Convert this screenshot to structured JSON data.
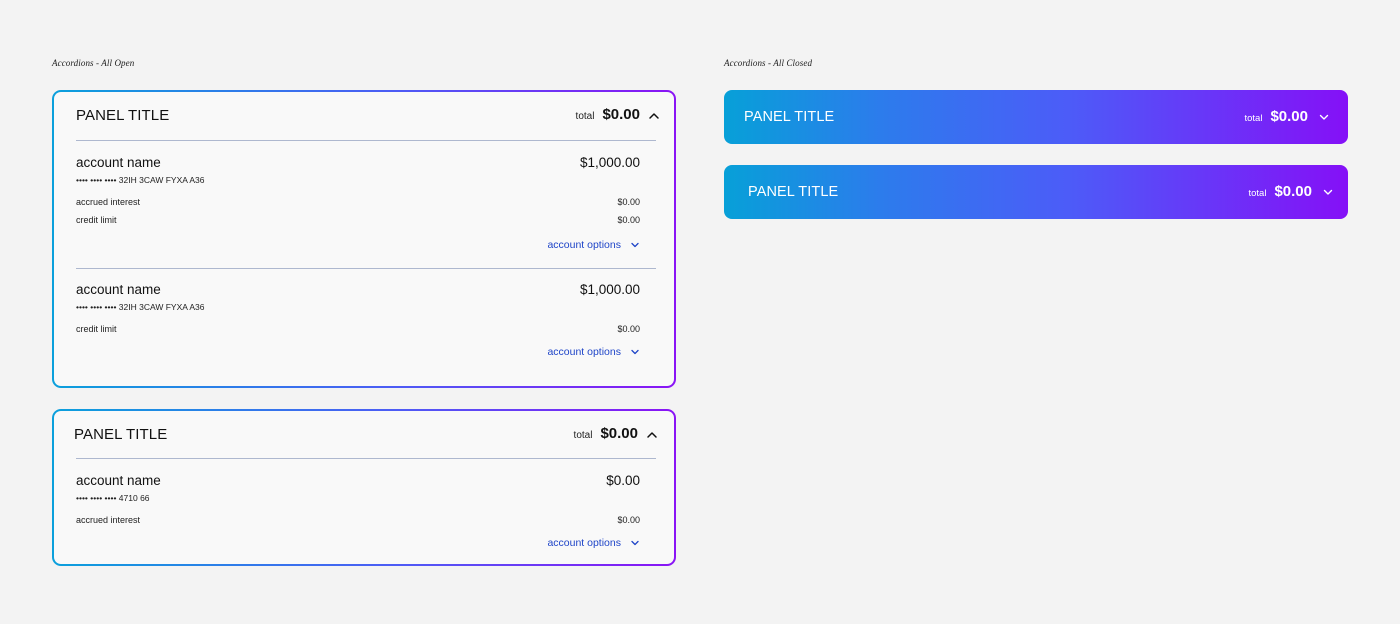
{
  "sections": {
    "open_label": "Accordions - All Open",
    "closed_label": "Accordions - All Closed"
  },
  "colors": {
    "gradient_start": "#0ba0dc",
    "gradient_mid": "#4d5cf5",
    "gradient_end": "#8a14f5",
    "link": "#1f45c8",
    "background": "#f3f3f3"
  },
  "icons": {
    "expanded": "chevron-up-icon",
    "collapsed": "chevron-down-icon"
  },
  "open_panels": [
    {
      "title": "PANEL TITLE",
      "total_label": "total",
      "total_value": "$0.00",
      "accounts": [
        {
          "name": "account name",
          "number": "•••• •••• •••• 32IH 3CAW FYXA A36",
          "amount": "$1,000.00",
          "details": [
            {
              "label": "accrued interest",
              "value": "$0.00"
            },
            {
              "label": "credit limit",
              "value": "$0.00"
            }
          ],
          "options_label": "account options"
        },
        {
          "name": "account name",
          "number": "•••• •••• •••• 32IH 3CAW FYXA A36",
          "amount": "$1,000.00",
          "details": [
            {
              "label": "credit limit",
              "value": "$0.00"
            }
          ],
          "options_label": "account options"
        }
      ]
    },
    {
      "title": "PANEL TITLE",
      "total_label": "total",
      "total_value": "$0.00",
      "accounts": [
        {
          "name": "account name",
          "number": "•••• •••• •••• 4710 66",
          "amount": "$0.00",
          "details": [
            {
              "label": "accrued interest",
              "value": "$0.00"
            }
          ],
          "options_label": "account options"
        }
      ]
    }
  ],
  "closed_panels": [
    {
      "title": "PANEL TITLE",
      "total_label": "total",
      "total_value": "$0.00"
    },
    {
      "title": "PANEL TITLE",
      "total_label": "total",
      "total_value": "$0.00"
    }
  ]
}
